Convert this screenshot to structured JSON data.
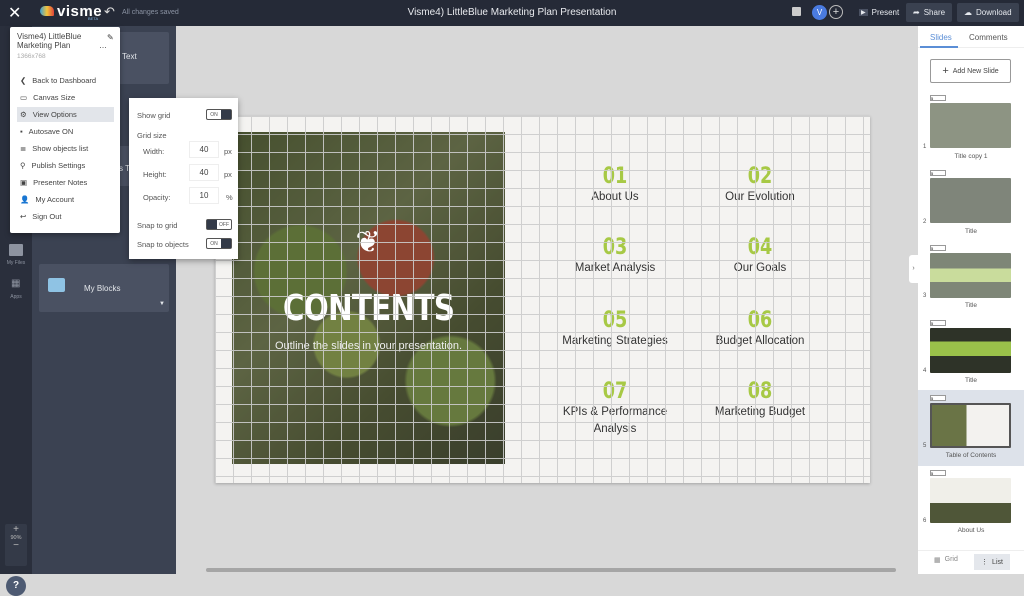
{
  "topbar": {
    "title": "Visme4) LittleBlue Marketing Plan Presentation",
    "logo": "visme",
    "beta": "BETA",
    "saved": "All changes saved",
    "avatar": "V",
    "present": "Present",
    "share": "Share",
    "download": "Download"
  },
  "menu": {
    "project_name": "Visme4) LittleBlue Marketing Plan",
    "dimensions": "1366x768",
    "items": [
      {
        "label": "Back to Dashboard",
        "icon": "chevron-left-icon"
      },
      {
        "label": "Canvas Size",
        "icon": "canvas-icon"
      },
      {
        "label": "View Options",
        "icon": "gear-icon"
      },
      {
        "label": "Autosave ON",
        "icon": "save-icon"
      },
      {
        "label": "Show objects list",
        "icon": "list-icon"
      },
      {
        "label": "Publish Settings",
        "icon": "publish-icon"
      },
      {
        "label": "Presenter Notes",
        "icon": "notes-icon"
      },
      {
        "label": "My Account",
        "icon": "user-icon"
      },
      {
        "label": "Sign Out",
        "icon": "sign-out-icon"
      }
    ]
  },
  "view_options": {
    "show_grid": "Show grid",
    "show_grid_state": "ON",
    "grid_size": "Grid size",
    "width_label": "Width:",
    "width": "40",
    "height_label": "Height:",
    "height": "40",
    "unit_px": "px",
    "opacity_label": "Opacity:",
    "opacity": "10",
    "unit_pct": "%",
    "snap_grid": "Snap to grid",
    "snap_grid_state": "OFF",
    "snap_objects": "Snap to objects",
    "snap_objects_state": "ON"
  },
  "left": {
    "card1": "Text",
    "card3": "s Te",
    "my_blocks": "My Blocks",
    "my_files": "My Files",
    "apps": "Apps",
    "zoom": "90%",
    "help": "?"
  },
  "slide": {
    "title": "CONTENTS",
    "subtitle": "Outline the slides in your presentation.",
    "items": [
      {
        "num": "01",
        "label": "About Us"
      },
      {
        "num": "02",
        "label": "Our Evolution"
      },
      {
        "num": "03",
        "label": "Market Analysis"
      },
      {
        "num": "04",
        "label": "Our Goals"
      },
      {
        "num": "05",
        "label": "Marketing Strategies"
      },
      {
        "num": "06",
        "label": "Budget Allocation"
      },
      {
        "num": "07",
        "label": "KPIs & Performance Analysis"
      },
      {
        "num": "08",
        "label": "Marketing Budget"
      }
    ]
  },
  "right": {
    "tab_slides": "Slides",
    "tab_comments": "Comments",
    "add_slide": "Add New Slide",
    "grid": "Grid",
    "list": "List",
    "slides": [
      {
        "n": "1",
        "name": "Title copy 1",
        "t": "5"
      },
      {
        "n": "2",
        "name": "Title",
        "t": "5"
      },
      {
        "n": "3",
        "name": "Title",
        "t": "5"
      },
      {
        "n": "4",
        "name": "Title",
        "t": "5"
      },
      {
        "n": "5",
        "name": "Table of Contents",
        "t": "5"
      },
      {
        "n": "6",
        "name": "About Us",
        "t": "5"
      }
    ]
  }
}
